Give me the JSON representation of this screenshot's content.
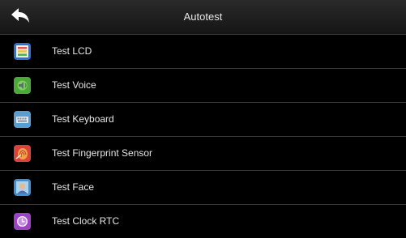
{
  "header": {
    "title": "Autotest",
    "back_icon": "back-arrow-icon"
  },
  "items": [
    {
      "label": "Test LCD",
      "icon": "lcd-test-icon"
    },
    {
      "label": "Test Voice",
      "icon": "voice-test-icon"
    },
    {
      "label": "Test Keyboard",
      "icon": "keyboard-test-icon"
    },
    {
      "label": "Test Fingerprint Sensor",
      "icon": "fingerprint-test-icon"
    },
    {
      "label": "Test Face",
      "icon": "face-test-icon"
    },
    {
      "label": "Test Clock RTC",
      "icon": "clock-test-icon"
    }
  ],
  "colors": {
    "background": "#000000",
    "divider": "#3c3c3c",
    "text": "#e6e6e6"
  }
}
